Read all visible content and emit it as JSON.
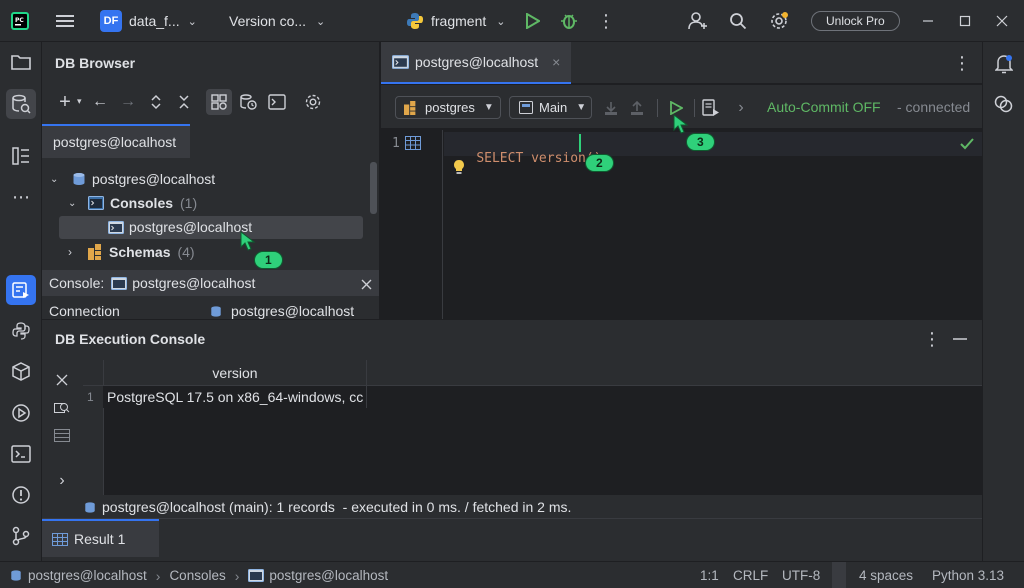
{
  "titlebar": {
    "project_badge": "DF",
    "project_name": "data_f...",
    "vcs_label": "Version co...",
    "run_config": "fragment",
    "unlock_label": "Unlock Pro"
  },
  "db_browser": {
    "title": "DB Browser",
    "connection_tab": "postgres@localhost",
    "tree": {
      "root": "postgres@localhost",
      "consoles_label": "Consoles",
      "consoles_count": "(1)",
      "console_item": "postgres@localhost",
      "schemas_label": "Schemas",
      "schemas_count": "(4)"
    },
    "details": {
      "console_prefix": "Console:",
      "console_name": "postgres@localhost",
      "connection_label": "Connection",
      "connection_value": "postgres@localhost"
    }
  },
  "editor": {
    "tab_label": "postgres@localhost",
    "toolbar": {
      "connection": "postgres",
      "schema": "Main",
      "autocommit": "Auto-Commit OFF",
      "status": "- connected"
    },
    "line_number": "1",
    "code": "SELECT version();"
  },
  "console": {
    "title": "DB Execution Console",
    "column_header": "version",
    "row_number": "1",
    "row_value": "PostgreSQL 17.5 on x86_64-windows, cc",
    "status_text": "postgres@localhost (main): 1 records  - executed in 0 ms. / fetched in 2 ms.",
    "result_tab": "Result 1"
  },
  "statusbar": {
    "crumb1": "postgres@localhost",
    "crumb2": "Consoles",
    "crumb3": "postgres@localhost",
    "position": "1:1",
    "line_sep": "CRLF",
    "encoding": "UTF-8",
    "indent": "4 spaces",
    "interpreter": "Python 3.13"
  },
  "markers": {
    "m1": "1",
    "m2": "2",
    "m3": "3"
  },
  "colors": {
    "accent": "#3574f0",
    "run_green": "#5fb865",
    "marker_green": "#2fd07a",
    "autocommit": "#5fb865"
  }
}
